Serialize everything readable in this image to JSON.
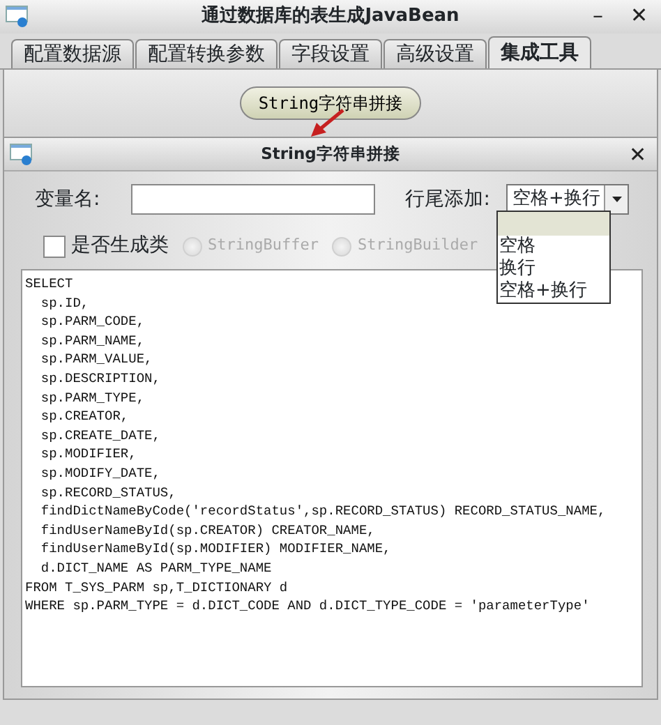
{
  "window": {
    "title": "通过数据库的表生成JavaBean",
    "minimize_glyph": "–",
    "close_glyph": "✕"
  },
  "tabs": [
    {
      "label": "配置数据源",
      "selected": false
    },
    {
      "label": "配置转换参数",
      "selected": false
    },
    {
      "label": "字段设置",
      "selected": false
    },
    {
      "label": "高级设置",
      "selected": false
    },
    {
      "label": "集成工具",
      "selected": true
    }
  ],
  "tool_button": "String字符串拼接",
  "dialog": {
    "title": "String字符串拼接",
    "close_glyph": "✕",
    "variable_label": "变量名:",
    "line_end_label": "行尾添加:",
    "line_end_value": "空格+换行",
    "line_end_options": [
      {
        "label": "空格",
        "selected": false
      },
      {
        "label": "换行",
        "selected": false
      },
      {
        "label": "空格+换行",
        "selected": false
      }
    ],
    "generate_class": {
      "label": "是否生成类",
      "checked": false
    },
    "class_types": [
      {
        "label": "StringBuffer",
        "selected": false,
        "disabled": true
      },
      {
        "label": "StringBuilder",
        "selected": false,
        "disabled": true
      }
    ],
    "sql_lines": [
      "SELECT",
      "  sp.ID,",
      "  sp.PARM_CODE,",
      "  sp.PARM_NAME,",
      "  sp.PARM_VALUE,",
      "  sp.DESCRIPTION,",
      "  sp.PARM_TYPE,",
      "  sp.CREATOR,",
      "  sp.CREATE_DATE,",
      "  sp.MODIFIER,",
      "  sp.MODIFY_DATE,",
      "  sp.RECORD_STATUS,",
      "  findDictNameByCode('recordStatus',sp.RECORD_STATUS) RECORD_STATUS_NAME,",
      "  findUserNameById(sp.CREATOR) CREATOR_NAME,",
      "  findUserNameById(sp.MODIFIER) MODIFIER_NAME,",
      "  d.DICT_NAME AS PARM_TYPE_NAME",
      "FROM T_SYS_PARM sp,T_DICTIONARY d",
      "WHERE sp.PARM_TYPE = d.DICT_CODE AND d.DICT_TYPE_CODE = 'parameterType'"
    ]
  }
}
